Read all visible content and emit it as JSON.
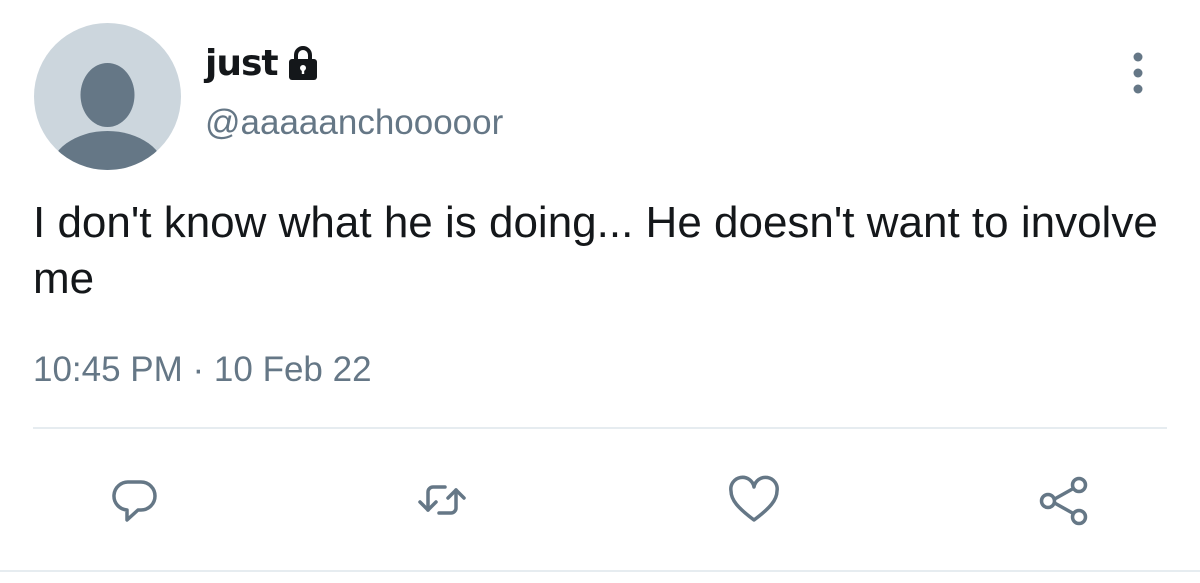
{
  "user": {
    "display_name": "just",
    "handle": "@aaaaanchooooor",
    "protected_icon": "lock-icon",
    "avatar": "default-avatar"
  },
  "tweet": {
    "text": "I don't know what he is doing... He doesn't want to involve me",
    "timestamp": "10:45 PM · 10 Feb 22"
  },
  "actions": {
    "more": "more-vertical-icon",
    "reply": "reply-icon",
    "retweet": "retweet-icon",
    "like": "heart-icon",
    "share": "share-icon"
  },
  "colors": {
    "primary_text": "#14171a",
    "secondary_text": "#657786",
    "avatar_bg": "#ccd6dd",
    "avatar_fg": "#657786",
    "divider": "#e6ecf0"
  }
}
